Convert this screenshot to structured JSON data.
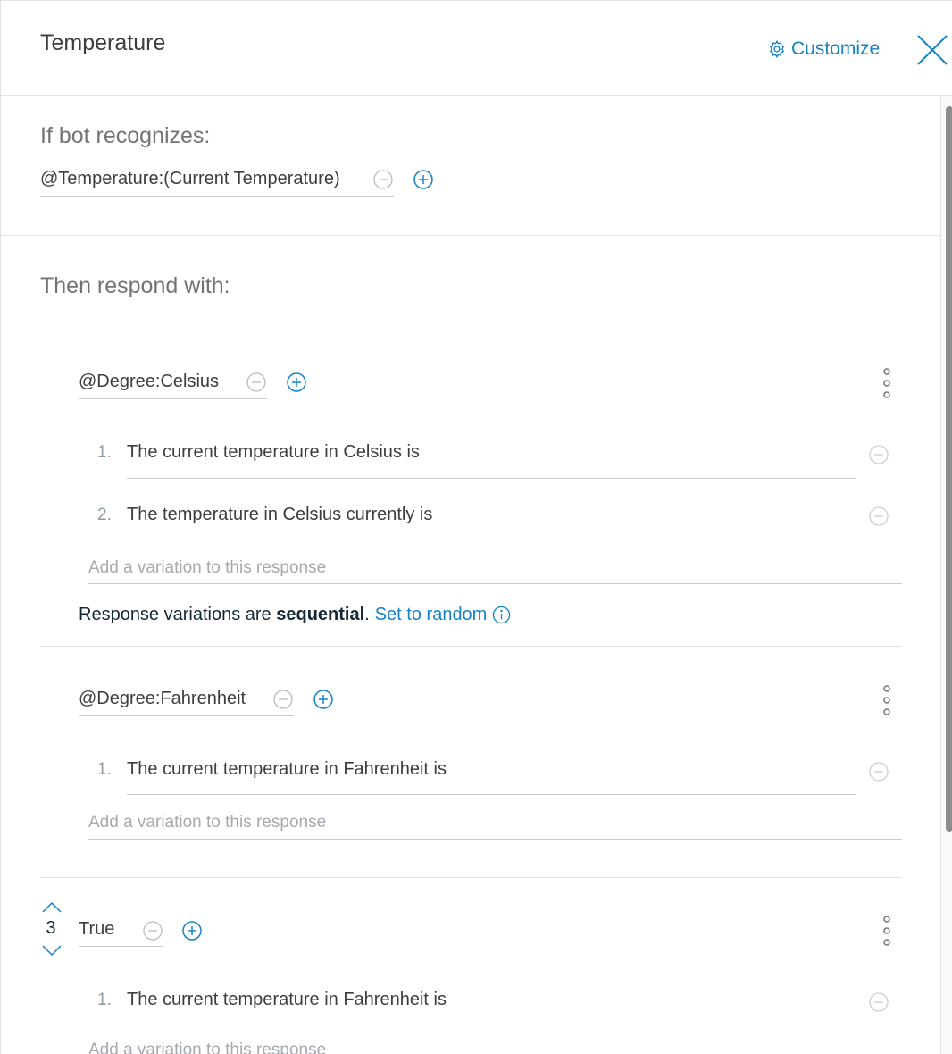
{
  "header": {
    "title": "Temperature",
    "customize_label": "Customize",
    "icons": {
      "settings": "gear-icon",
      "close": "close-icon"
    }
  },
  "condition": {
    "heading": "If bot recognizes:",
    "value": "@Temperature:(Current Temperature)"
  },
  "responses": {
    "heading": "Then respond with:",
    "add_placeholder": "Add a variation to this response",
    "blocks": [
      {
        "condition": "@Degree:Celsius",
        "variations": [
          {
            "num": "1.",
            "text": "The current temperature in Celsius is"
          },
          {
            "num": "2.",
            "text": "The temperature in Celsius currently is"
          }
        ],
        "mode": {
          "prefix": "Response variations are ",
          "value": "sequential",
          "suffix": ".",
          "link": "Set to random"
        }
      },
      {
        "condition": "@Degree:Fahrenheit",
        "variations": [
          {
            "num": "1.",
            "text": "The current temperature in Fahrenheit is"
          }
        ]
      },
      {
        "order": "3",
        "condition": "True",
        "variations": [
          {
            "num": "1.",
            "text": "The current temperature in Fahrenheit is"
          }
        ]
      }
    ]
  },
  "colors": {
    "accent": "#1583c4",
    "muted_icon": "#b5bcc2",
    "divider": "#dfe3e6"
  }
}
